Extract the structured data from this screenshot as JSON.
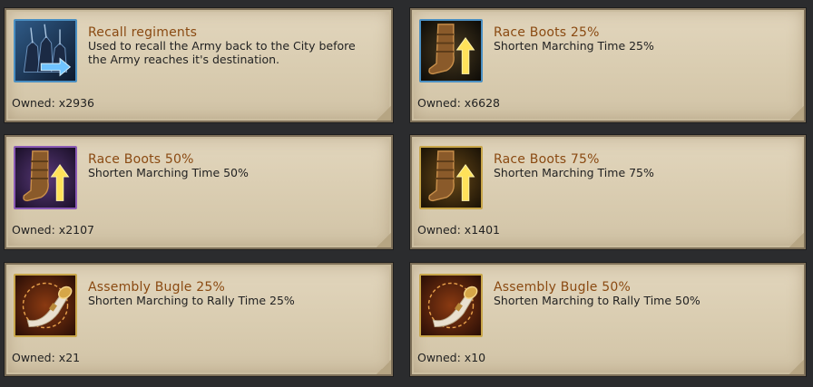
{
  "items": [
    {
      "title": "Recall regiments",
      "description": "Used to recall the Army back to the City before\n the Army reaches it's destination.",
      "owned": "Owned: x2936",
      "icon": "recall-army-icon",
      "icon_border": "#4a8fc2"
    },
    {
      "title": "Race Boots 25%",
      "description": "Shorten Marching Time 25%",
      "owned": "Owned: x6628",
      "icon": "race-boots-icon",
      "icon_border": "#4a8fc2"
    },
    {
      "title": "Race Boots 50%",
      "description": "Shorten Marching Time 50%",
      "owned": "Owned: x2107",
      "icon": "race-boots-icon",
      "icon_border": "#8a5ab5"
    },
    {
      "title": "Race Boots 75%",
      "description": "Shorten Marching Time 75%",
      "owned": "Owned: x1401",
      "icon": "race-boots-icon",
      "icon_border": "#c8a64a"
    },
    {
      "title": "Assembly Bugle 25%",
      "description": "Shorten Marching to Rally Time 25%",
      "owned": "Owned: x21",
      "icon": "assembly-bugle-icon",
      "icon_border": "#c8a64a"
    },
    {
      "title": "Assembly Bugle 50%",
      "description": "Shorten Marching to Rally Time 50%",
      "owned": "Owned: x10",
      "icon": "assembly-bugle-icon",
      "icon_border": "#c8a64a"
    }
  ]
}
